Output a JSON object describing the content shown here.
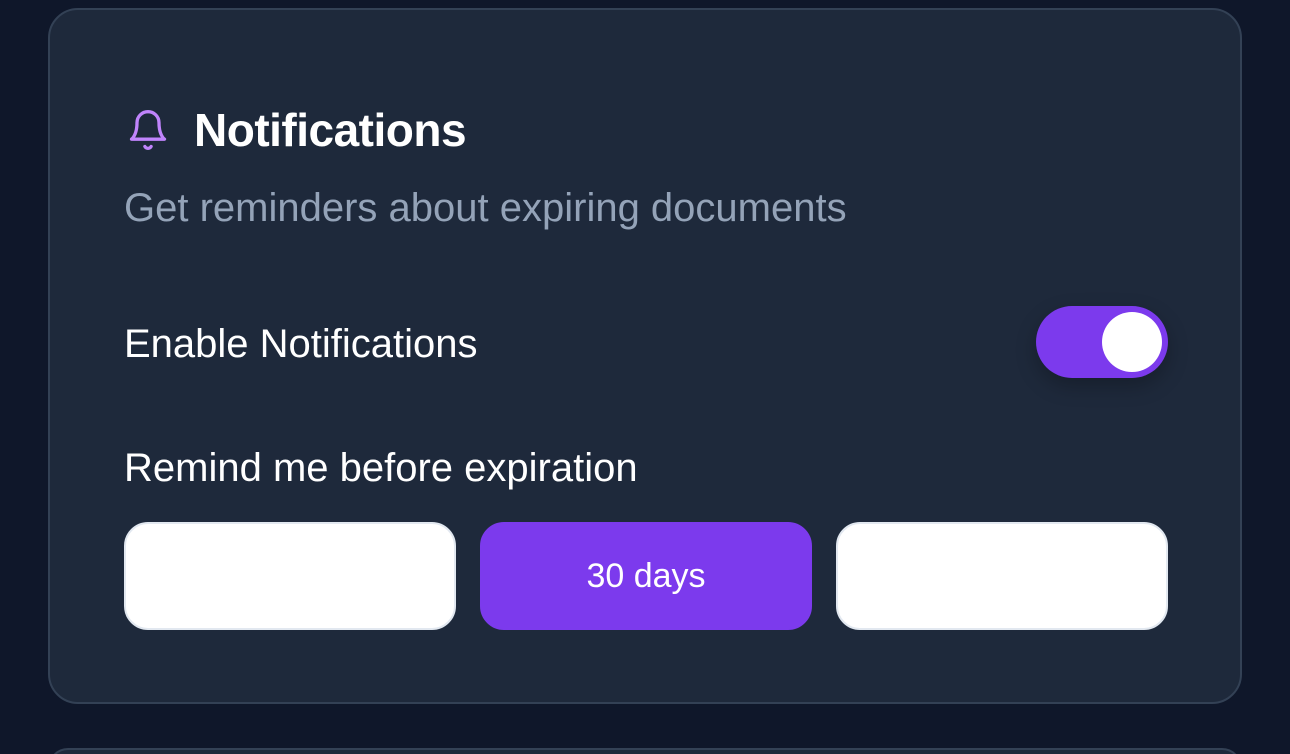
{
  "notifications_card": {
    "title": "Notifications",
    "title_icon": "bell-icon",
    "subtitle": "Get reminders about expiring documents",
    "enable_label": "Enable Notifications",
    "enable_toggle": {
      "on": true
    },
    "reminder_label": "Remind me before expiration",
    "reminder_options": [
      {
        "label": "",
        "selected": false
      },
      {
        "label": "30 days",
        "selected": true
      },
      {
        "label": "",
        "selected": false
      }
    ]
  },
  "colors": {
    "background": "#0f172a",
    "card": "#1e293b",
    "card_border": "#334155",
    "accent": "#7c3aed",
    "accent_icon": "#c084fc",
    "muted_text": "#94a3b8",
    "text": "#ffffff"
  }
}
